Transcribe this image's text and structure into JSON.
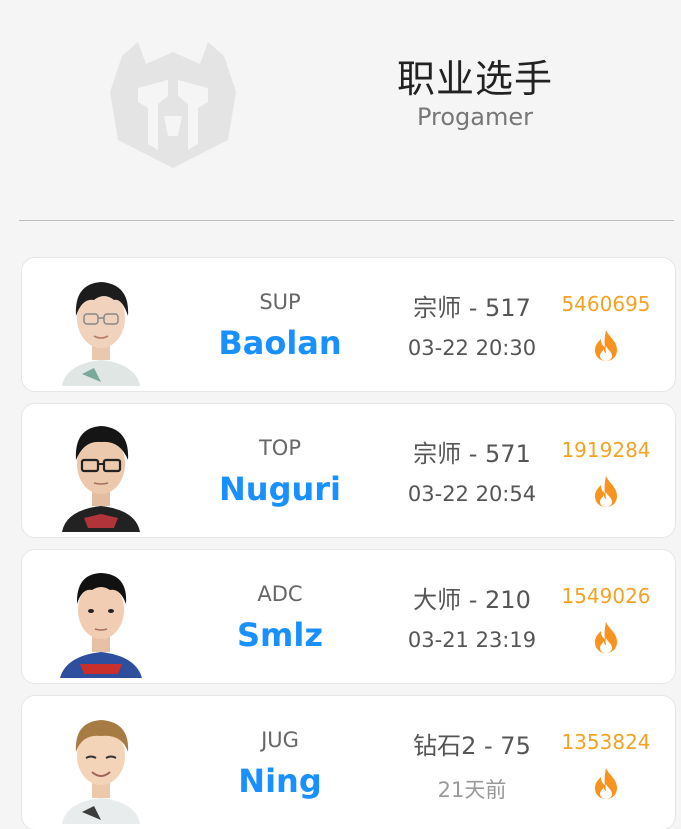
{
  "header": {
    "title": "职业选手",
    "subtitle": "Progamer",
    "logo_icon": "team-logo-icon"
  },
  "colors": {
    "accent_name": "#1890ff",
    "score": "#f4a223",
    "fire": "#f7931e"
  },
  "players": [
    {
      "role": "SUP",
      "name": "Baolan",
      "rank": "宗师 - 517",
      "time": "03-22 20:30",
      "score": "5460695",
      "icon": "fire-icon"
    },
    {
      "role": "TOP",
      "name": "Nuguri",
      "rank": "宗师 - 571",
      "time": "03-22 20:54",
      "score": "1919284",
      "icon": "fire-icon"
    },
    {
      "role": "ADC",
      "name": "Smlz",
      "rank": "大师 - 210",
      "time": "03-21 23:19",
      "score": "1549026",
      "icon": "fire-icon"
    },
    {
      "role": "JUG",
      "name": "Ning",
      "rank": "钻石2 - 75",
      "time": "21天前",
      "score": "1353824",
      "icon": "fire-icon"
    }
  ]
}
